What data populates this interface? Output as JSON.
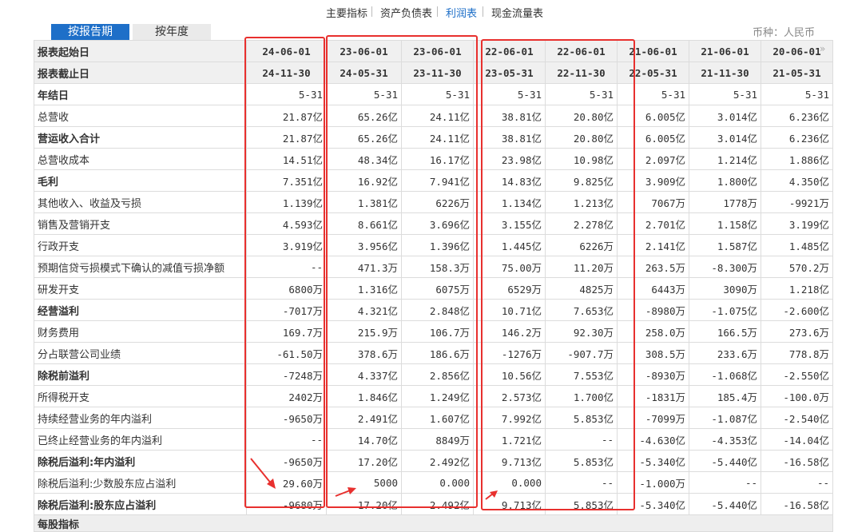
{
  "top_nav": {
    "items": [
      {
        "label": "主要指标",
        "active": false
      },
      {
        "label": "资产负债表",
        "active": false
      },
      {
        "label": "利润表",
        "active": true
      },
      {
        "label": "现金流量表",
        "active": false
      }
    ]
  },
  "period_tabs": {
    "report_period": "按报告期",
    "annual": "按年度"
  },
  "currency_label": "币种：人民币",
  "header_rows": [
    {
      "label": "报表起始日",
      "cells": [
        "24-06-01",
        "23-06-01",
        "23-06-01",
        "22-06-01",
        "22-06-01",
        "21-06-01",
        "21-06-01",
        "20-06-01"
      ]
    },
    {
      "label": "报表截止日",
      "cells": [
        "24-11-30",
        "24-05-31",
        "23-11-30",
        "23-05-31",
        "22-11-30",
        "22-05-31",
        "21-11-30",
        "21-05-31"
      ]
    }
  ],
  "rows": [
    {
      "label": "年结日",
      "bold": true,
      "cells": [
        "5-31",
        "5-31",
        "5-31",
        "5-31",
        "5-31",
        "5-31",
        "5-31",
        "5-31"
      ]
    },
    {
      "label": "总营收",
      "bold": false,
      "cells": [
        "21.87亿",
        "65.26亿",
        "24.11亿",
        "38.81亿",
        "20.80亿",
        "6.005亿",
        "3.014亿",
        "6.236亿"
      ]
    },
    {
      "label": "营运收入合计",
      "bold": true,
      "cells": [
        "21.87亿",
        "65.26亿",
        "24.11亿",
        "38.81亿",
        "20.80亿",
        "6.005亿",
        "3.014亿",
        "6.236亿"
      ]
    },
    {
      "label": "总营收成本",
      "bold": false,
      "cells": [
        "14.51亿",
        "48.34亿",
        "16.17亿",
        "23.98亿",
        "10.98亿",
        "2.097亿",
        "1.214亿",
        "1.886亿"
      ]
    },
    {
      "label": "毛利",
      "bold": true,
      "cells": [
        "7.351亿",
        "16.92亿",
        "7.941亿",
        "14.83亿",
        "9.825亿",
        "3.909亿",
        "1.800亿",
        "4.350亿"
      ]
    },
    {
      "label": "其他收入、收益及亏损",
      "bold": false,
      "cells": [
        "1.139亿",
        "1.381亿",
        "6226万",
        "1.134亿",
        "1.213亿",
        "7067万",
        "1778万",
        "-9921万"
      ]
    },
    {
      "label": "销售及营销开支",
      "bold": false,
      "cells": [
        "4.593亿",
        "8.661亿",
        "3.696亿",
        "3.155亿",
        "2.278亿",
        "2.701亿",
        "1.158亿",
        "3.199亿"
      ]
    },
    {
      "label": "行政开支",
      "bold": false,
      "cells": [
        "3.919亿",
        "3.956亿",
        "1.396亿",
        "1.445亿",
        "6226万",
        "2.141亿",
        "1.587亿",
        "1.485亿"
      ]
    },
    {
      "label": "预期信贷亏损模式下确认的减值亏损净额",
      "bold": false,
      "cells": [
        "--",
        "471.3万",
        "158.3万",
        "75.00万",
        "11.20万",
        "263.5万",
        "-8.300万",
        "570.2万"
      ]
    },
    {
      "label": "研发开支",
      "bold": false,
      "cells": [
        "6800万",
        "1.316亿",
        "6075万",
        "6529万",
        "4825万",
        "6443万",
        "3090万",
        "1.218亿"
      ]
    },
    {
      "label": "经营溢利",
      "bold": true,
      "cells": [
        "-7017万",
        "4.321亿",
        "2.848亿",
        "10.71亿",
        "7.653亿",
        "-8980万",
        "-1.075亿",
        "-2.600亿"
      ]
    },
    {
      "label": "财务费用",
      "bold": false,
      "cells": [
        "169.7万",
        "215.9万",
        "106.7万",
        "146.2万",
        "92.30万",
        "258.0万",
        "166.5万",
        "273.6万"
      ]
    },
    {
      "label": "分占联营公司业绩",
      "bold": false,
      "cells": [
        "-61.50万",
        "378.6万",
        "186.6万",
        "-1276万",
        "-907.7万",
        "308.5万",
        "233.6万",
        "778.8万"
      ]
    },
    {
      "label": "除税前溢利",
      "bold": true,
      "cells": [
        "-7248万",
        "4.337亿",
        "2.856亿",
        "10.56亿",
        "7.553亿",
        "-8930万",
        "-1.068亿",
        "-2.550亿"
      ]
    },
    {
      "label": "所得税开支",
      "bold": false,
      "cells": [
        "2402万",
        "1.846亿",
        "1.249亿",
        "2.573亿",
        "1.700亿",
        "-1831万",
        "185.4万",
        "-100.0万"
      ]
    },
    {
      "label": "持续经营业务的年内溢利",
      "bold": false,
      "cells": [
        "-9650万",
        "2.491亿",
        "1.607亿",
        "7.992亿",
        "5.853亿",
        "-7099万",
        "-1.087亿",
        "-2.540亿"
      ]
    },
    {
      "label": "已终止经营业务的年内溢利",
      "bold": false,
      "cells": [
        "--",
        "14.70亿",
        "8849万",
        "1.721亿",
        "--",
        "-4.630亿",
        "-4.353亿",
        "-14.04亿"
      ]
    },
    {
      "label": "除税后溢利:年内溢利",
      "bold": true,
      "cells": [
        "-9650万",
        "17.20亿",
        "2.492亿",
        "9.713亿",
        "5.853亿",
        "-5.340亿",
        "-5.440亿",
        "-16.58亿"
      ]
    },
    {
      "label": "除税后溢利:少数股东应占溢利",
      "bold": false,
      "cells": [
        "29.60万",
        "5000",
        "0.000",
        "0.000",
        "--",
        "-1.000万",
        "--",
        "--"
      ]
    },
    {
      "label": "除税后溢利:股东应占溢利",
      "bold": true,
      "cells": [
        "-9680万",
        "17.20亿",
        "2.492亿",
        "9.713亿",
        "5.853亿",
        "-5.340亿",
        "-5.440亿",
        "-16.58亿"
      ]
    }
  ],
  "section_title": "每股指标",
  "colors": {
    "accent": "#1e6fc8",
    "annotation": "#e8302e",
    "header_bg": "#f0f0f0"
  }
}
